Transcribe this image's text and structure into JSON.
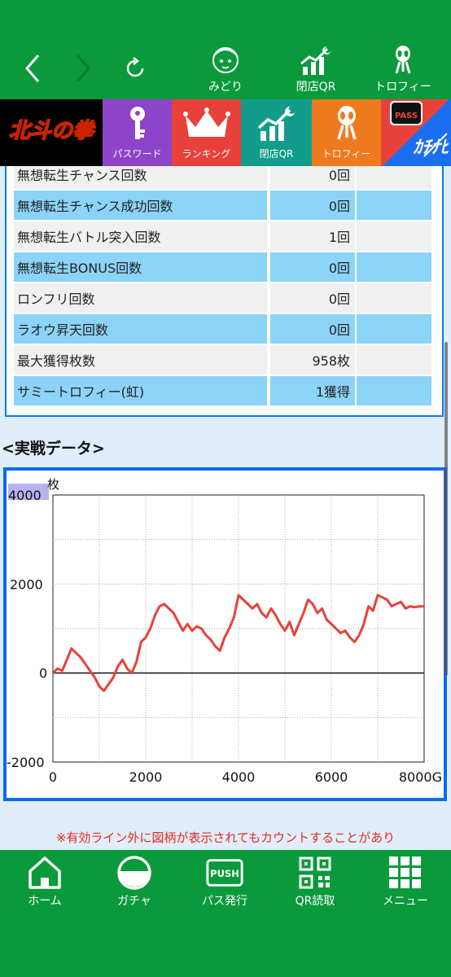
{
  "header": {
    "nav_items": [
      {
        "label": "みどり",
        "icon": "character-icon"
      },
      {
        "label": "閉店QR",
        "icon": "chart-up-icon"
      },
      {
        "label": "トロフィー",
        "icon": "trophy-alien-icon"
      }
    ]
  },
  "categories": [
    {
      "label": "北斗の拳",
      "icon": "hokuto-logo",
      "color": "#000000"
    },
    {
      "label": "パスワード",
      "icon": "key-icon",
      "color": "#8e44c8"
    },
    {
      "label": "ランキング",
      "icon": "crown-icon",
      "color": "#e8413b"
    },
    {
      "label": "閉店QR",
      "icon": "chart-up-icon",
      "color": "#119c8c"
    },
    {
      "label": "トロフィー",
      "icon": "trophy-alien-icon",
      "color": "#ef7a1e"
    },
    {
      "label": "PASS",
      "icon": "pass-badge-icon",
      "color": "#e8413b"
    }
  ],
  "stats": {
    "rows": [
      {
        "label": "無想転生チャンス回数",
        "value": "0回"
      },
      {
        "label": "無想転生チャンス成功回数",
        "value": "0回"
      },
      {
        "label": "無想転生バトル突入回数",
        "value": "1回"
      },
      {
        "label": "無想転生BONUS回数",
        "value": "0回"
      },
      {
        "label": "ロンフリ回数",
        "value": "0回"
      },
      {
        "label": "ラオウ昇天回数",
        "value": "0回"
      },
      {
        "label": "最大獲得枚数",
        "value": "958枚"
      },
      {
        "label": "サミートロフィー(虹)",
        "value": "1獲得"
      }
    ]
  },
  "section_title": "<実戦データ>",
  "chart_data": {
    "type": "line",
    "ylabel": "枚",
    "xlabel": "",
    "xlim": [
      0,
      8000
    ],
    "ylim": [
      -2000,
      4000
    ],
    "x_ticks": [
      "0",
      "2000",
      "4000",
      "6000",
      "8000G"
    ],
    "y_ticks": [
      "4000",
      "2000",
      "0",
      "-2000"
    ],
    "line_color": "#e8413b",
    "series": [
      {
        "x": [
          0,
          100,
          200,
          300,
          400,
          500,
          600,
          700,
          800,
          900,
          1000,
          1100,
          1200,
          1300,
          1400,
          1500,
          1600,
          1700,
          1800,
          1900,
          2000,
          2100,
          2200,
          2300,
          2400,
          2500,
          2600,
          2700,
          2800,
          2900,
          3000,
          3100,
          3200,
          3300,
          3400,
          3500,
          3600,
          3700,
          3800,
          3900,
          4000,
          4100,
          4200,
          4300,
          4400,
          4500,
          4600,
          4700,
          4800,
          4900,
          5000,
          5100,
          5200,
          5300,
          5400,
          5500,
          5600,
          5700,
          5800,
          5900,
          6000,
          6100,
          6200,
          6300,
          6400,
          6500,
          6600,
          6700,
          6800,
          6900,
          7000,
          7100,
          7200,
          7300,
          7400,
          7500,
          7600,
          7700,
          7800,
          7900,
          8000
        ],
        "y": [
          0,
          100,
          50,
          300,
          550,
          450,
          350,
          200,
          50,
          -100,
          -300,
          -400,
          -250,
          -100,
          150,
          300,
          100,
          0,
          250,
          700,
          800,
          1000,
          1300,
          1500,
          1550,
          1450,
          1350,
          1150,
          950,
          1100,
          950,
          1050,
          1000,
          850,
          750,
          600,
          500,
          800,
          1000,
          1250,
          1750,
          1650,
          1550,
          1450,
          1550,
          1350,
          1250,
          1450,
          1300,
          1100,
          950,
          1150,
          850,
          1100,
          1350,
          1650,
          1550,
          1350,
          1450,
          1200,
          1100,
          1000,
          900,
          950,
          800,
          700,
          850,
          1100,
          1500,
          1400,
          1750,
          1700,
          1650,
          1500,
          1550,
          1600,
          1450,
          1500,
          1480,
          1500,
          1500
        ]
      }
    ]
  },
  "notice": "※有効ライン外に図柄が表示されてもカウントすることがあり",
  "bottom_nav": [
    {
      "label": "ホーム",
      "icon": "home-icon"
    },
    {
      "label": "ガチャ",
      "icon": "gacha-icon"
    },
    {
      "label": "パス発行",
      "icon": "push-icon"
    },
    {
      "label": "QR読取",
      "icon": "qr-icon"
    },
    {
      "label": "メニュー",
      "icon": "menu-grid-icon"
    }
  ],
  "colors": {
    "brand_green": "#0a9a3c",
    "row_blue": "#8cd3f8",
    "row_gray": "#f0f0f0",
    "chart_border": "#0a6af0",
    "notice_red": "#e8281c"
  }
}
